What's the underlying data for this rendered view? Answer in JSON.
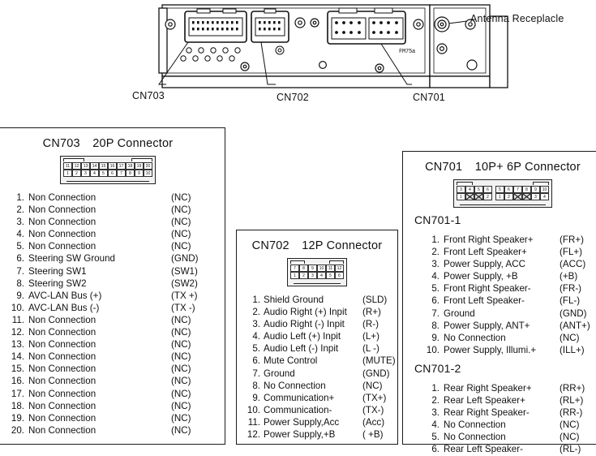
{
  "illustration": {
    "callouts": [
      {
        "id": "cn703",
        "label": "CN703"
      },
      {
        "id": "cn702",
        "label": "CN702"
      },
      {
        "id": "cn701",
        "label": "CN701"
      },
      {
        "id": "antenna",
        "label": "Antenna Receplacle"
      }
    ],
    "fuse_marking": "FM75a"
  },
  "panels": {
    "cn703": {
      "title_name": "CN703",
      "title_type": "20P Connector",
      "connector": {
        "top_row": [
          "11",
          "12",
          "13",
          "14",
          "15",
          "16",
          "17",
          "18",
          "19",
          "20"
        ],
        "bottom_row": [
          "1",
          "2",
          "3",
          "4",
          "5",
          "6",
          "7",
          "8",
          "9",
          "10"
        ]
      },
      "pins": [
        {
          "n": "1.",
          "desc": "Non Connection",
          "code": "(NC)"
        },
        {
          "n": "2.",
          "desc": "Non Connection",
          "code": "(NC)"
        },
        {
          "n": "3.",
          "desc": "Non Connection",
          "code": "(NC)"
        },
        {
          "n": "4.",
          "desc": "Non Connection",
          "code": "(NC)"
        },
        {
          "n": "5.",
          "desc": "Non Connection",
          "code": "(NC)"
        },
        {
          "n": "6.",
          "desc": "Steering SW Ground",
          "code": "(GND)"
        },
        {
          "n": "7.",
          "desc": "Steering SW1",
          "code": "(SW1)"
        },
        {
          "n": "8.",
          "desc": "Steering SW2",
          "code": "(SW2)"
        },
        {
          "n": "9.",
          "desc": "AVC-LAN Bus (+)",
          "code": "(TX +)"
        },
        {
          "n": "10.",
          "desc": "AVC-LAN Bus (-)",
          "code": "(TX -)"
        },
        {
          "n": "11.",
          "desc": "Non Connection",
          "code": "(NC)"
        },
        {
          "n": "12.",
          "desc": "Non Connection",
          "code": "(NC)"
        },
        {
          "n": "13.",
          "desc": "Non Connection",
          "code": "(NC)"
        },
        {
          "n": "14.",
          "desc": "Non Connection",
          "code": "(NC)"
        },
        {
          "n": "15.",
          "desc": "Non Connection",
          "code": "(NC)"
        },
        {
          "n": "16.",
          "desc": "Non Connection",
          "code": "(NC)"
        },
        {
          "n": "17.",
          "desc": "Non Connection",
          "code": "(NC)"
        },
        {
          "n": "18.",
          "desc": "Non Connection",
          "code": "(NC)"
        },
        {
          "n": "19.",
          "desc": "Non Connection",
          "code": "(NC)"
        },
        {
          "n": "20.",
          "desc": "Non Connection",
          "code": "(NC)"
        }
      ]
    },
    "cn702": {
      "title_name": "CN702",
      "title_type": "12P Connector",
      "connector": {
        "top_row": [
          "7",
          "8",
          "9",
          "10",
          "11",
          "12"
        ],
        "bottom_row": [
          "1",
          "2",
          "3",
          "4",
          "5",
          "6"
        ]
      },
      "pins": [
        {
          "n": "1.",
          "desc": "Shield Ground",
          "code": "(SLD)"
        },
        {
          "n": "2.",
          "desc": "Audio Right (+) Inpit",
          "code": "(R+)"
        },
        {
          "n": "3.",
          "desc": "Audio Right (-) Inpit",
          "code": "(R-)"
        },
        {
          "n": "4.",
          "desc": "Audio Left (+) Inpit",
          "code": "(L+)"
        },
        {
          "n": "5.",
          "desc": "Audio Left (-) Inpit",
          "code": "(L -)"
        },
        {
          "n": "6.",
          "desc": "Mute Control",
          "code": "(MUTE)"
        },
        {
          "n": "7.",
          "desc": "Ground",
          "code": "(GND)"
        },
        {
          "n": "8.",
          "desc": "No Connection",
          "code": "(NC)"
        },
        {
          "n": "9.",
          "desc": "Communication+",
          "code": "(TX+)"
        },
        {
          "n": "10.",
          "desc": "Communication-",
          "code": "(TX-)"
        },
        {
          "n": "11.",
          "desc": "Power Supply,Acc",
          "code": "(Acc)"
        },
        {
          "n": "12.",
          "desc": "Power Supply,+B",
          "code": "( +B)"
        }
      ]
    },
    "cn701": {
      "title_name": "CN701",
      "title_type": "10P+ 6P Connector",
      "connector": {
        "left_top": [
          "3",
          "4",
          "5",
          "6"
        ],
        "left_bottom": [
          "1",
          "X",
          "",
          "2"
        ],
        "right_top": [
          "5",
          "6",
          "7",
          "8",
          "9",
          "10"
        ],
        "right_bottom": [
          "1",
          "2",
          "",
          "X",
          "3",
          "4"
        ]
      },
      "sub1": {
        "title": "CN701-1",
        "pins": [
          {
            "n": "1.",
            "desc": "Front Right Speaker+",
            "code": "(FR+)"
          },
          {
            "n": "2.",
            "desc": "Front Left Speaker+",
            "code": "(FL+)"
          },
          {
            "n": "3.",
            "desc": "Power Supply, ACC",
            "code": "(ACC)"
          },
          {
            "n": "4.",
            "desc": "Power Supply, +B",
            "code": "(+B)"
          },
          {
            "n": "5.",
            "desc": "Front Right Speaker-",
            "code": "(FR-)"
          },
          {
            "n": "6.",
            "desc": "Front Left Speaker-",
            "code": "(FL-)"
          },
          {
            "n": "7.",
            "desc": "Ground",
            "code": "(GND)"
          },
          {
            "n": "8.",
            "desc": "Power Supply, ANT+",
            "code": "(ANT+)"
          },
          {
            "n": "9.",
            "desc": "No Connection",
            "code": "(NC)"
          },
          {
            "n": "10.",
            "desc": "Power Supply, Illumi.+",
            "code": "(ILL+)"
          }
        ]
      },
      "sub2": {
        "title": "CN701-2",
        "pins": [
          {
            "n": "1.",
            "desc": "Rear Right Speaker+",
            "code": "(RR+)"
          },
          {
            "n": "2.",
            "desc": "Rear Left Speaker+",
            "code": "(RL+)"
          },
          {
            "n": "3.",
            "desc": "Rear Right Speaker-",
            "code": "(RR-)"
          },
          {
            "n": "4.",
            "desc": "No Connection",
            "code": "(NC)"
          },
          {
            "n": "5.",
            "desc": "No Connection",
            "code": "(NC)"
          },
          {
            "n": "6.",
            "desc": "Rear Left Speaker-",
            "code": "(RL-)"
          }
        ]
      }
    }
  }
}
